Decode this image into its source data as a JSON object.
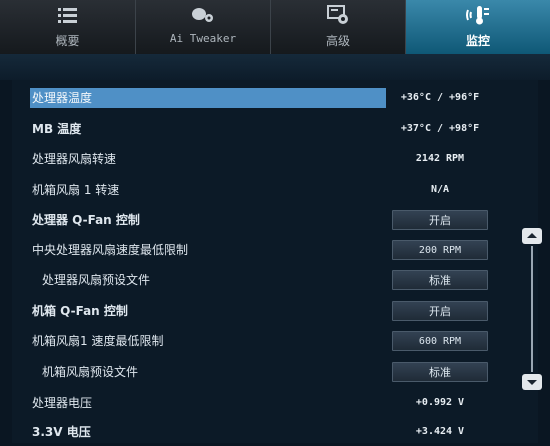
{
  "tabs": [
    {
      "label": "概要",
      "icon": "list-icon"
    },
    {
      "label": "Ai Tweaker",
      "icon": "tweaker-icon"
    },
    {
      "label": "高级",
      "icon": "advanced-icon"
    },
    {
      "label": "监控",
      "icon": "monitor-icon",
      "active": true
    }
  ],
  "rows": [
    {
      "name": "处理器温度",
      "value": "+36°C / +96°F"
    },
    {
      "name": "MB 温度",
      "value": "+37°C / +98°F"
    },
    {
      "name": "处理器风扇转速",
      "value": "2142 RPM"
    },
    {
      "name": "机箱风扇 1 转速",
      "value": "N/A"
    },
    {
      "name": "处理器 Q-Fan 控制",
      "option": "开启"
    },
    {
      "name": "中央处理器风扇速度最低限制",
      "option": "200 RPM"
    },
    {
      "name": "处理器风扇预设文件",
      "option": "标准"
    },
    {
      "name": "机箱 Q-Fan 控制",
      "option": "开启"
    },
    {
      "name": "机箱风扇1 速度最低限制",
      "option": "600 RPM"
    },
    {
      "name": "机箱风扇预设文件",
      "option": "标准"
    },
    {
      "name": "处理器电压",
      "value": "+0.992 V"
    },
    {
      "name": "3.3V 电压",
      "value": "+3.424 V"
    }
  ],
  "colors": {
    "accent": "#4f90c6",
    "active_tab": "#2a7ba0",
    "background": "#0a1622"
  }
}
